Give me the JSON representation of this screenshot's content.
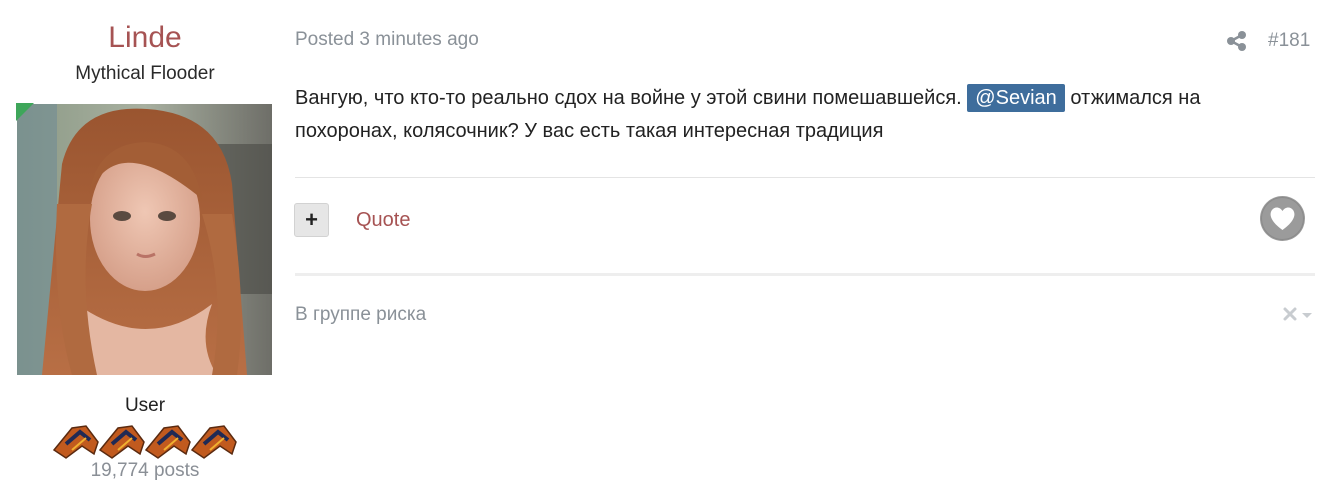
{
  "author": {
    "name": "Linde",
    "title": "Mythical Flooder",
    "group": "User",
    "posts": "19,774 posts",
    "online_color": "#3ea65a",
    "name_color": "#a65353"
  },
  "post": {
    "time": "Posted 3 minutes ago",
    "number": "#181",
    "text_before": "Вангую, что кто-то реально сдох на войне у этой свини помешавшейся. ",
    "mention": "@Sevian",
    "text_after": " отжимался на похоронах, колясочник? У вас есть такая интересная традиция",
    "mention_color": "#3e6d9c"
  },
  "actions": {
    "add_label": "+",
    "quote_label": "Quote",
    "share_icon": "share-icon",
    "like_icon": "heart-icon"
  },
  "signature": {
    "text": "В группе риска",
    "hide_icon": "close-icon",
    "menu_icon": "caret-down-icon"
  }
}
